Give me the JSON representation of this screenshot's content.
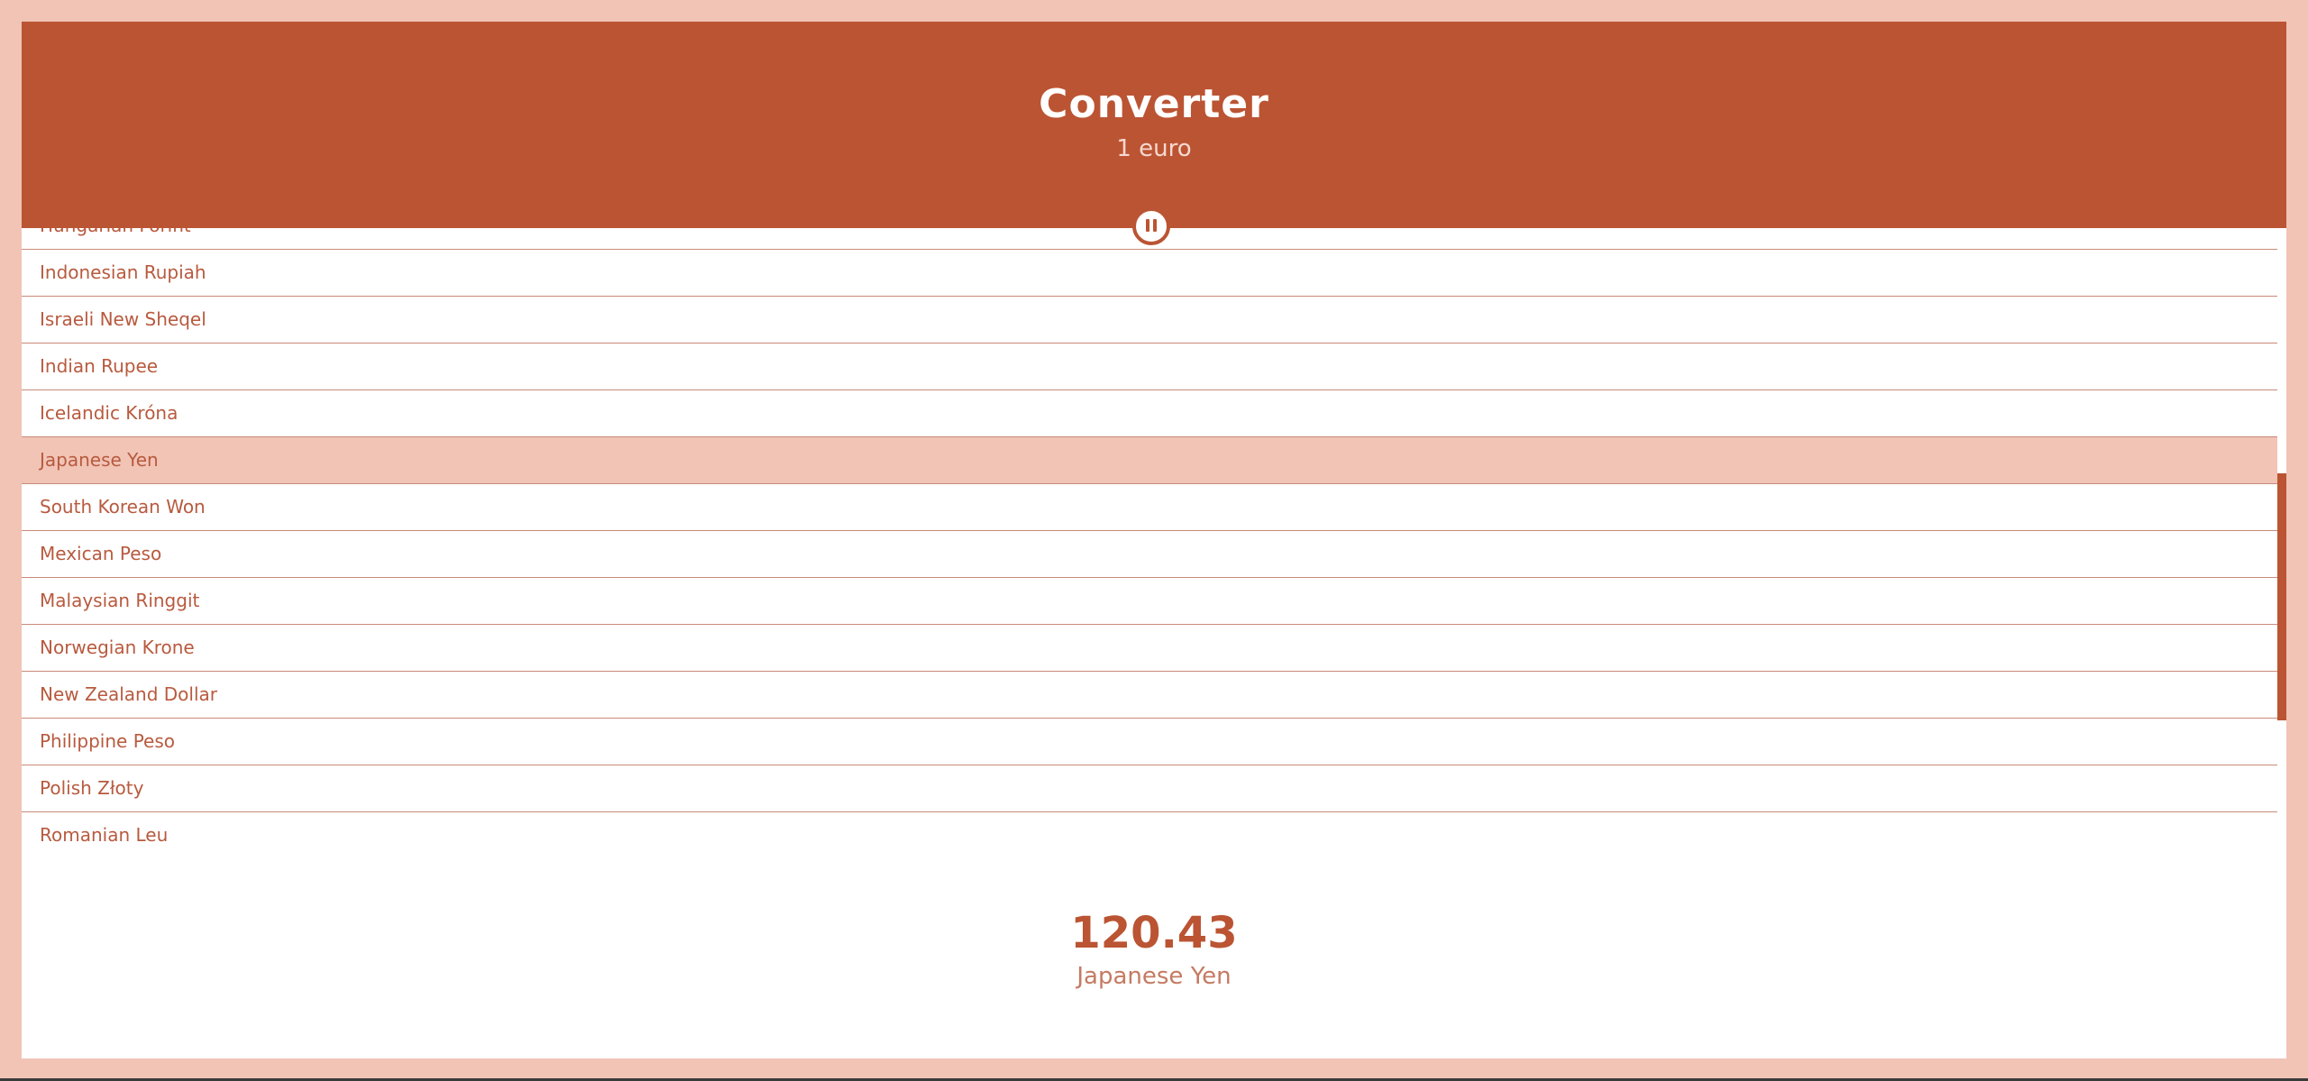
{
  "header": {
    "title": "Converter",
    "subtitle": "1 euro"
  },
  "controls": {
    "pause_icon": "pause-icon"
  },
  "currencies": [
    {
      "label": "Hungarian Forint",
      "selected": false
    },
    {
      "label": "Indonesian Rupiah",
      "selected": false
    },
    {
      "label": "Israeli New Sheqel",
      "selected": false
    },
    {
      "label": "Indian Rupee",
      "selected": false
    },
    {
      "label": "Icelandic Króna",
      "selected": false
    },
    {
      "label": "Japanese Yen",
      "selected": true
    },
    {
      "label": "South Korean Won",
      "selected": false
    },
    {
      "label": "Mexican Peso",
      "selected": false
    },
    {
      "label": "Malaysian Ringgit",
      "selected": false
    },
    {
      "label": "Norwegian Krone",
      "selected": false
    },
    {
      "label": "New Zealand Dollar",
      "selected": false
    },
    {
      "label": "Philippine Peso",
      "selected": false
    },
    {
      "label": "Polish Złoty",
      "selected": false
    },
    {
      "label": "Romanian Leu",
      "selected": false
    }
  ],
  "result": {
    "value": "120.43",
    "currency": "Japanese Yen"
  },
  "colors": {
    "background": "#f1c4b6",
    "accent": "#bb5433",
    "selected_row": "#f1c4b6",
    "surface": "#ffffff"
  }
}
